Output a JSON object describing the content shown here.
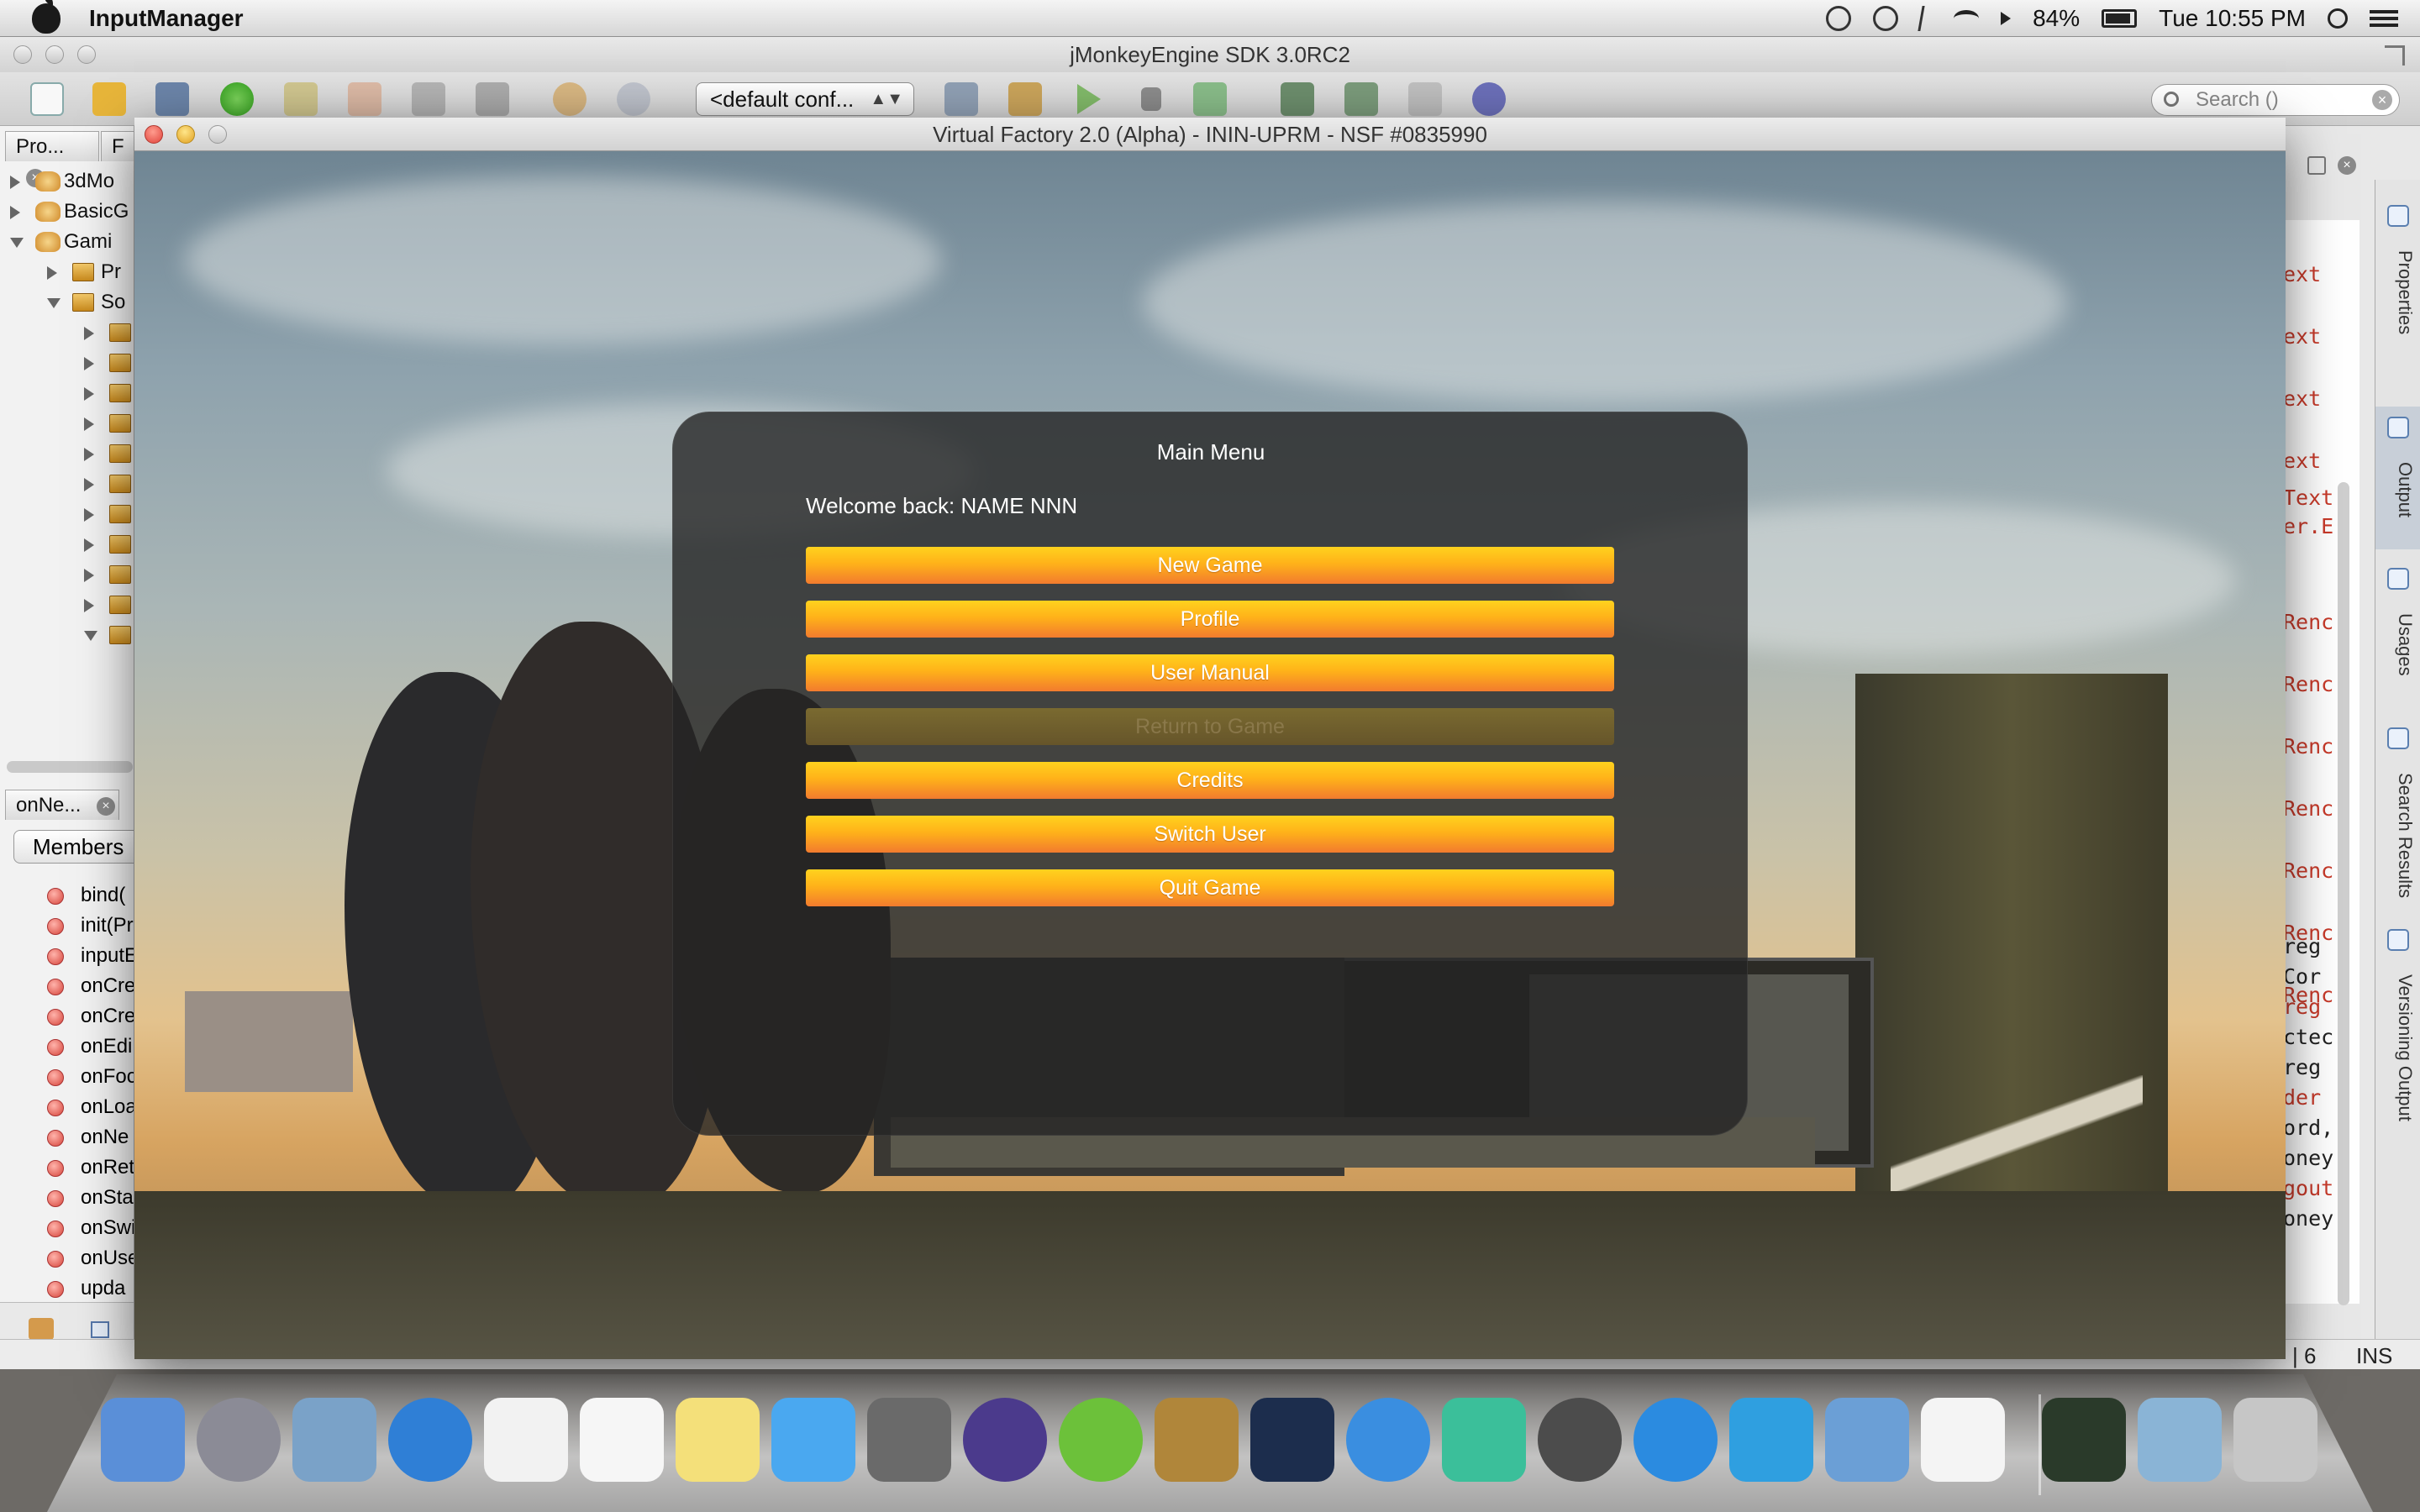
{
  "menubar": {
    "app_name": "InputManager",
    "battery": "84%",
    "battery_level": 0.84,
    "clock": "Tue 10:55 PM"
  },
  "sdk": {
    "title": "jMonkeyEngine SDK 3.0RC2",
    "config_select": "<default conf...",
    "search_placeholder": "Search ()",
    "projects_tab": "Pro...",
    "files_tab_initial": "F",
    "navigator_tab": "onNe...",
    "members_button": "Members",
    "status_position": "| 6",
    "status_mode": "INS",
    "tree": [
      {
        "label": "3dMo",
        "level": 0,
        "expanded": false,
        "icon": "project-icon"
      },
      {
        "label": "BasicG",
        "level": 0,
        "expanded": false,
        "icon": "project-icon"
      },
      {
        "label": "Gami",
        "level": 0,
        "expanded": true,
        "icon": "project-icon"
      },
      {
        "label": "Pr",
        "level": 1,
        "expanded": false,
        "icon": "properties-icon"
      },
      {
        "label": "So",
        "level": 1,
        "expanded": true,
        "icon": "source-folder-icon"
      },
      {
        "label": "",
        "level": 2,
        "expanded": false,
        "icon": "package-icon"
      },
      {
        "label": "",
        "level": 2,
        "expanded": false,
        "icon": "package-icon"
      },
      {
        "label": "",
        "level": 2,
        "expanded": false,
        "icon": "package-icon"
      },
      {
        "label": "",
        "level": 2,
        "expanded": false,
        "icon": "package-icon"
      },
      {
        "label": "",
        "level": 2,
        "expanded": false,
        "icon": "package-icon"
      },
      {
        "label": "",
        "level": 2,
        "expanded": false,
        "icon": "package-icon"
      },
      {
        "label": "",
        "level": 2,
        "expanded": false,
        "icon": "package-icon"
      },
      {
        "label": "",
        "level": 2,
        "expanded": false,
        "icon": "package-icon"
      },
      {
        "label": "",
        "level": 2,
        "expanded": false,
        "icon": "package-icon"
      },
      {
        "label": "",
        "level": 2,
        "expanded": false,
        "icon": "package-icon"
      },
      {
        "label": "",
        "level": 2,
        "expanded": true,
        "icon": "package-icon"
      }
    ],
    "members": [
      "bind(",
      "init(Pr",
      "inputE",
      "onCre",
      "onCre",
      "onEdi",
      "onFoc",
      "onLoa",
      "onNe",
      "onRet",
      "onSta",
      "onSwi",
      "onUse",
      "upda"
    ],
    "code_lines": [
      "ext",
      "ext",
      "ext",
      "ext",
      "Text",
      "er.E",
      "Renc",
      "Renc",
      "Renc",
      "Renc",
      "Renc",
      "Renc",
      "Renc",
      "reg",
      "Cor",
      "reg",
      "ctec",
      "reg",
      "der",
      "ord,",
      "oney",
      "gout",
      "oney"
    ],
    "side_panel": [
      "Properties",
      "Output",
      "Usages",
      "Search Results",
      "Versioning Output"
    ]
  },
  "game": {
    "window_title": "Virtual Factory 2.0 (Alpha) - ININ-UPRM - NSF #0835990",
    "menu_title": "Main Menu",
    "welcome": "Welcome back: NAME NNN",
    "buttons": [
      {
        "label": "New Game",
        "enabled": true
      },
      {
        "label": "Profile",
        "enabled": true
      },
      {
        "label": "User Manual",
        "enabled": true
      },
      {
        "label": "Return to Game",
        "enabled": false
      },
      {
        "label": "Credits",
        "enabled": true
      },
      {
        "label": "Switch User",
        "enabled": true
      },
      {
        "label": "Quit Game",
        "enabled": true
      }
    ]
  },
  "dock": [
    {
      "name": "finder-icon",
      "color": "#5a8fd8"
    },
    {
      "name": "launchpad-icon",
      "color": "#8b8b96"
    },
    {
      "name": "mail-icon",
      "color": "#7aa2c8"
    },
    {
      "name": "safari-icon",
      "color": "#2f7fd6"
    },
    {
      "name": "calendar-icon",
      "color": "#f2f2f2"
    },
    {
      "name": "reminders-icon",
      "color": "#f6f6f6"
    },
    {
      "name": "stickies-icon",
      "color": "#f4e07a"
    },
    {
      "name": "messages-icon",
      "color": "#4aa8f0"
    },
    {
      "name": "facetime-icon",
      "color": "#6a6a6a"
    },
    {
      "name": "eclipse-icon",
      "color": "#4b3a8c"
    },
    {
      "name": "brackets-icon",
      "color": "#6cc13a"
    },
    {
      "name": "cyberduck-icon",
      "color": "#b0863a"
    },
    {
      "name": "photoshop-icon",
      "color": "#1c2d4d"
    },
    {
      "name": "itunes-icon",
      "color": "#3a8ee0"
    },
    {
      "name": "galaga-icon",
      "color": "#3bbf9a"
    },
    {
      "name": "mine-icon",
      "color": "#4c4c4c"
    },
    {
      "name": "app-store-icon",
      "color": "#2b8be0"
    },
    {
      "name": "word-icon",
      "color": "#2f9fe0"
    },
    {
      "name": "xcode-icon",
      "color": "#6b9fd6"
    },
    {
      "name": "java-icon",
      "color": "#f4f4f4"
    },
    {
      "name": "activity-monitor-icon",
      "color": "#2a3a2a"
    },
    {
      "name": "downloads-folder-icon",
      "color": "#8ab4d6"
    },
    {
      "name": "trash-icon",
      "color": "#c6c6c6"
    }
  ]
}
